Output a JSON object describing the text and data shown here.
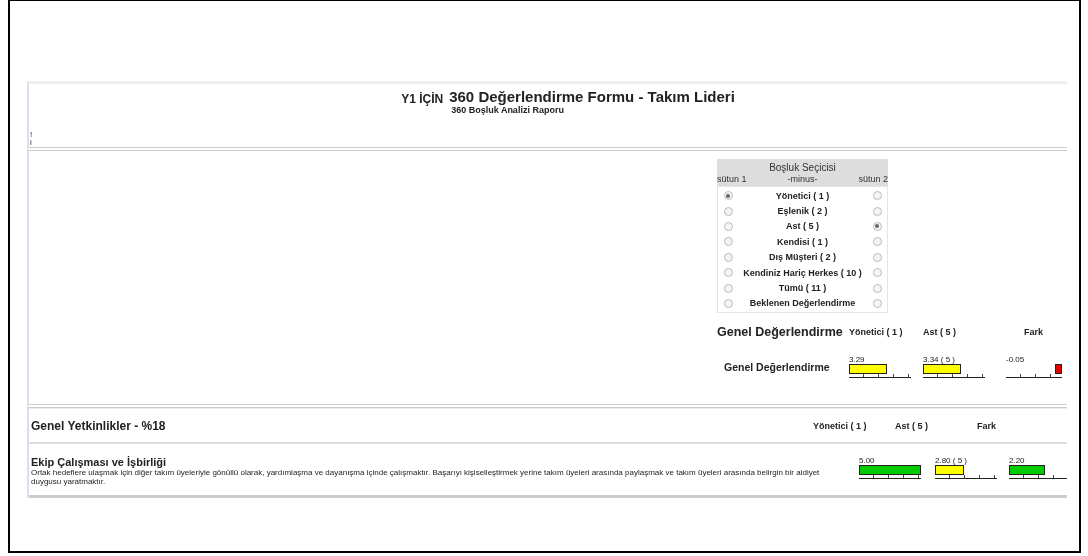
{
  "header": {
    "prefix": "Y1 İÇİN",
    "title": "360 Değerlendirme Formu - Takım Lideri",
    "subtitle": "360 Boşluk Analizi Raporu",
    "marks": [
      "!",
      "i"
    ]
  },
  "gap_selector": {
    "title": "Boşluk Seçicisi",
    "left_label": "sütun 1",
    "middle_label": "-minus-",
    "right_label": "sütun 2",
    "options": [
      {
        "label": "Yönetici ( 1 )",
        "left_selected": true,
        "right_selected": false
      },
      {
        "label": "Eşlenik ( 2 )",
        "left_selected": false,
        "right_selected": false
      },
      {
        "label": "Ast ( 5 )",
        "left_selected": false,
        "right_selected": true
      },
      {
        "label": "Kendisi ( 1 )",
        "left_selected": false,
        "right_selected": false
      },
      {
        "label": "Dış Müşteri ( 2 )",
        "left_selected": false,
        "right_selected": false
      },
      {
        "label": "Kendiniz Hariç Herkes ( 10 )",
        "left_selected": false,
        "right_selected": false
      },
      {
        "label": "Tümü ( 11 )",
        "left_selected": false,
        "right_selected": false
      },
      {
        "label": "Beklenen Değerlendirme",
        "left_selected": false,
        "right_selected": false
      }
    ]
  },
  "overall": {
    "heading": "Genel Değerlendirme",
    "columns": [
      "Yönetici ( 1 )",
      "Ast ( 5 )",
      "Fark"
    ],
    "rows": [
      {
        "label": "Genel Değerlendirme",
        "bars": [
          {
            "reading": "3.29",
            "level": 0.62,
            "color": "#ffff00"
          },
          {
            "reading": "3.34 ( 5 )",
            "level": 0.62,
            "color": "#ffff00"
          },
          {
            "reading": "-0.05",
            "level": 0.12,
            "color": "#dd0000",
            "kind": "negative"
          }
        ]
      }
    ]
  },
  "sections": [
    {
      "heading": "Genel Yetkinlikler - %18",
      "columns": [
        "Yönetici ( 1 )",
        "Ast ( 5 )",
        "Fark"
      ],
      "items": [
        {
          "title": "Ekip Çalışması ve İşbirliği",
          "description": "Ortak hedeflere ulaşmak için diğer takım üyeleriyle gönüllü olarak, yardımlaşma ve dayanışma içinde çalışmaktır. Başarıyı kişiselleştirmek yerine takım üyeleri arasında paylaşmak ve takım üyeleri arasında belirgin bir aidiyet duygusu yaratmaktır.",
          "bars": [
            {
              "reading": "5.00",
              "level": 1.0,
              "color": "#00cc00"
            },
            {
              "reading": "2.80 ( 5 )",
              "level": 0.47,
              "color": "#ffff00"
            },
            {
              "reading": "2.20",
              "level": 0.6,
              "color": "#00cc00"
            }
          ]
        }
      ]
    }
  ]
}
